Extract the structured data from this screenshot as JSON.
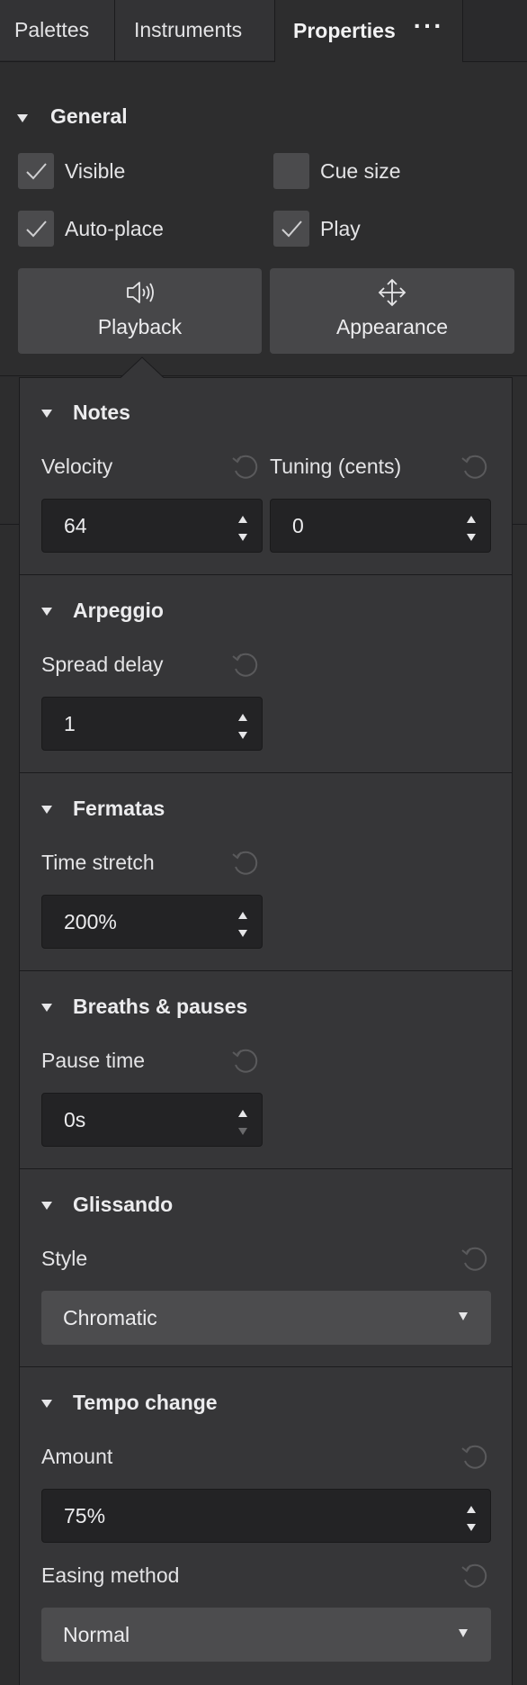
{
  "tabs": [
    {
      "label": "Palettes"
    },
    {
      "label": "Instruments"
    },
    {
      "label": "Properties"
    }
  ],
  "tab_more": "···",
  "general": {
    "title": "General",
    "visible": {
      "label": "Visible",
      "checked": true
    },
    "cue_size": {
      "label": "Cue size",
      "checked": false
    },
    "auto_place": {
      "label": "Auto-place",
      "checked": true
    },
    "play": {
      "label": "Play",
      "checked": true
    },
    "playback_button": {
      "label": "Playback",
      "icon": "speaker-icon"
    },
    "appearance_button": {
      "label": "Appearance",
      "icon": "move-arrows-icon"
    }
  },
  "notes": {
    "title": "Notes",
    "velocity_label": "Velocity",
    "velocity_value": "64",
    "tuning_label": "Tuning (cents)",
    "tuning_value": "0"
  },
  "arpeggio": {
    "title": "Arpeggio",
    "spread_label": "Spread delay",
    "spread_value": "1"
  },
  "fermatas": {
    "title": "Fermatas",
    "stretch_label": "Time stretch",
    "stretch_value": "200%"
  },
  "breaths": {
    "title": "Breaths & pauses",
    "pause_label": "Pause time",
    "pause_value": "0s"
  },
  "glissando": {
    "title": "Glissando",
    "style_label": "Style",
    "style_value": "Chromatic"
  },
  "tempo_change": {
    "title": "Tempo change",
    "amount_label": "Amount",
    "amount_value": "75%",
    "easing_label": "Easing method",
    "easing_value": "Normal"
  },
  "colors": {
    "background": "#2d2d2e",
    "popup": "#363638",
    "input": "#232325",
    "button": "#474749"
  }
}
